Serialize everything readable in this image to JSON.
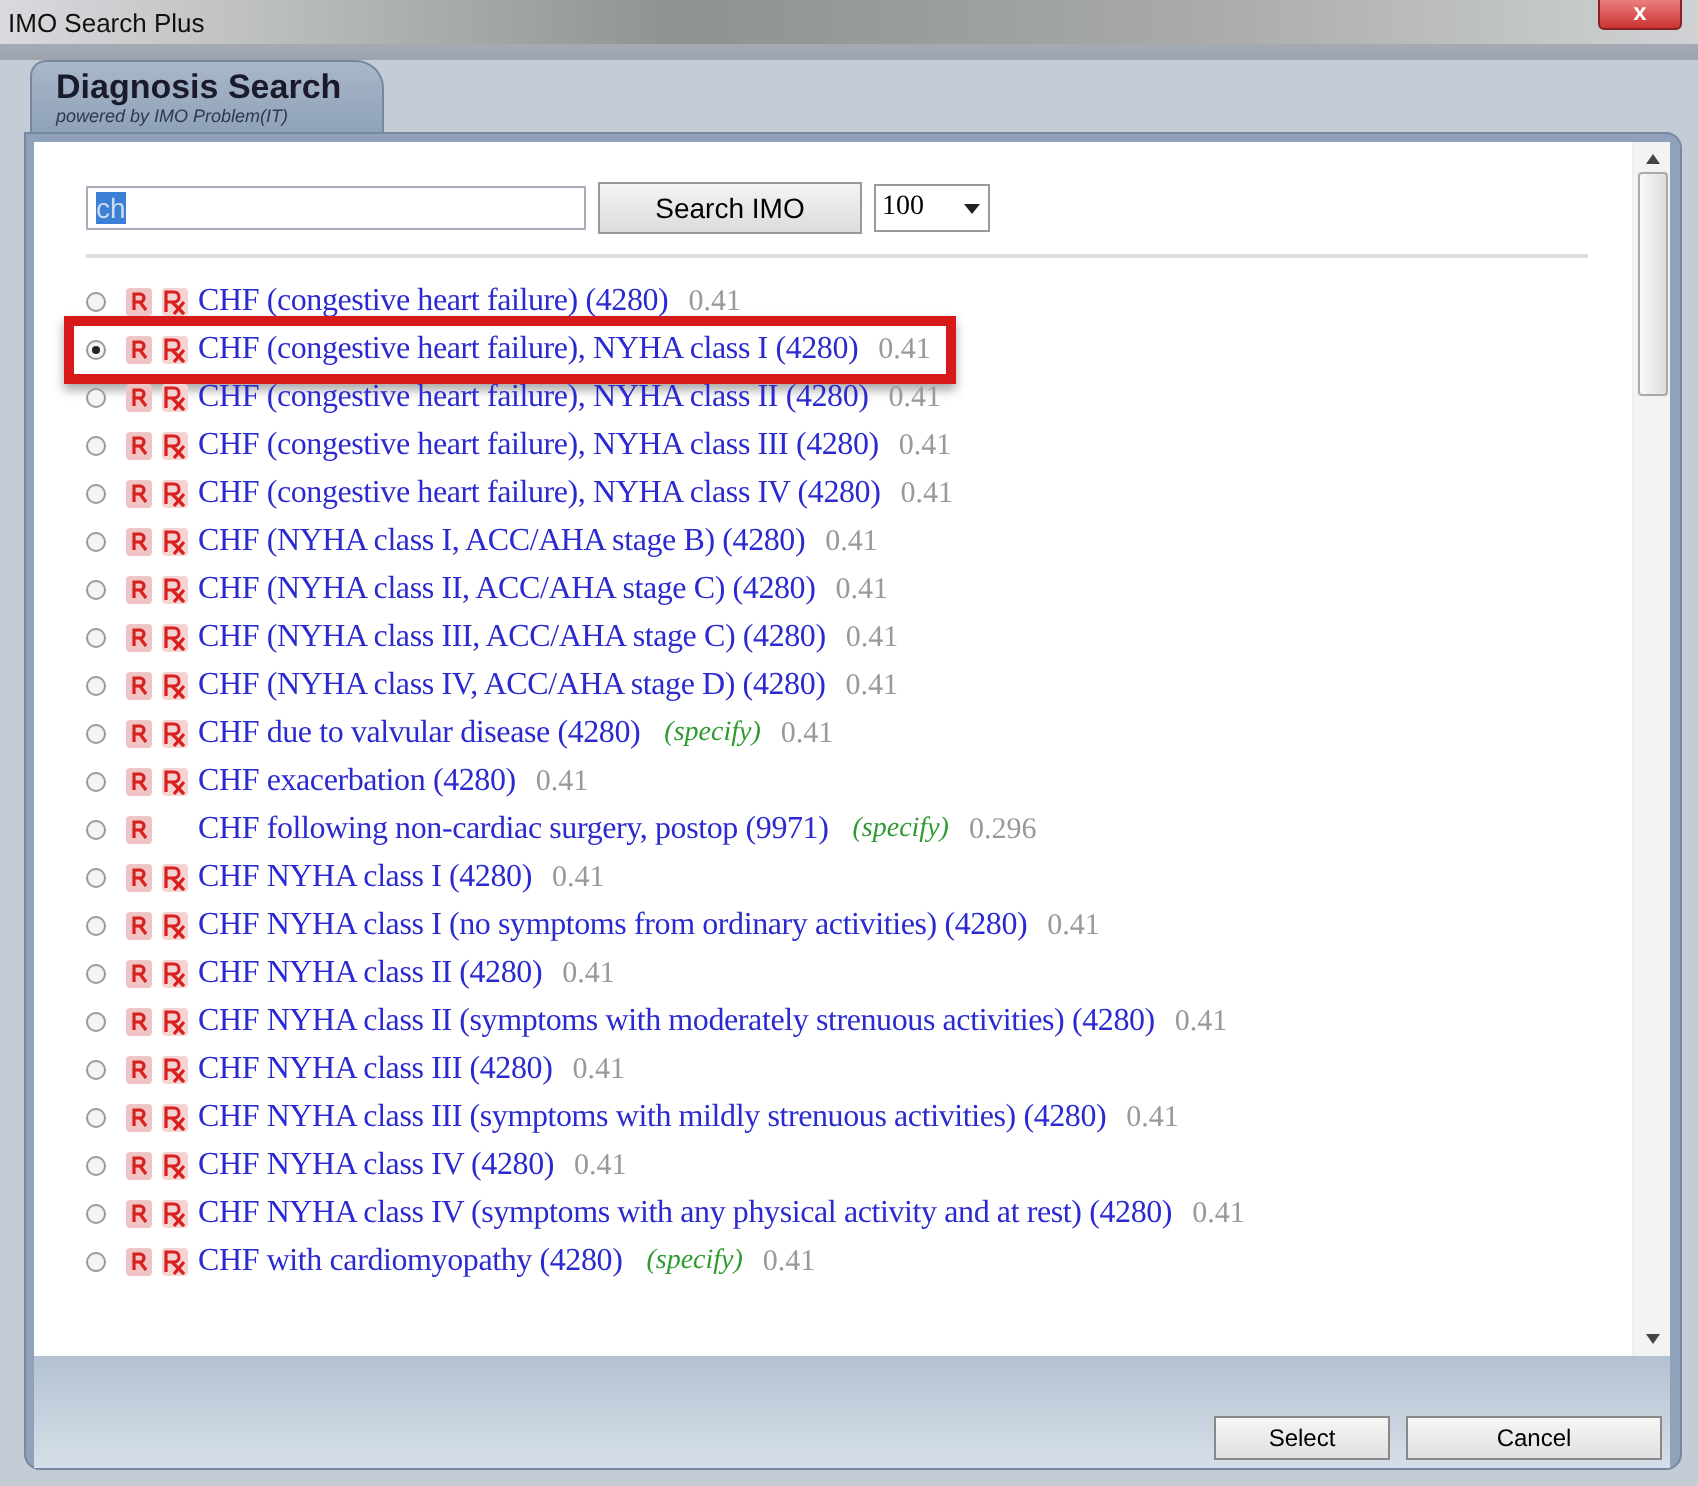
{
  "window": {
    "title": "IMO Search Plus",
    "close": "x"
  },
  "tab": {
    "title": "Diagnosis Search",
    "subtitle": "powered by IMO Problem(IT)"
  },
  "search": {
    "value": "ch",
    "button": "Search IMO",
    "limit": "100"
  },
  "results": [
    {
      "text": "CHF (congestive heart failure) (4280)",
      "rx": true,
      "score": "0.41",
      "selected": false,
      "highlighted": false
    },
    {
      "text": "CHF (congestive heart failure), NYHA class I (4280)",
      "rx": true,
      "score": "0.41",
      "selected": true,
      "highlighted": true
    },
    {
      "text": "CHF (congestive heart failure), NYHA class II (4280)",
      "rx": true,
      "score": "0.41",
      "selected": false,
      "highlighted": false
    },
    {
      "text": "CHF (congestive heart failure), NYHA class III (4280)",
      "rx": true,
      "score": "0.41",
      "selected": false,
      "highlighted": false
    },
    {
      "text": "CHF (congestive heart failure), NYHA class IV (4280)",
      "rx": true,
      "score": "0.41",
      "selected": false,
      "highlighted": false
    },
    {
      "text": "CHF (NYHA class I, ACC/AHA stage B) (4280)",
      "rx": true,
      "score": "0.41",
      "selected": false,
      "highlighted": false
    },
    {
      "text": "CHF (NYHA class II, ACC/AHA stage C) (4280)",
      "rx": true,
      "score": "0.41",
      "selected": false,
      "highlighted": false
    },
    {
      "text": "CHF (NYHA class III, ACC/AHA stage C) (4280)",
      "rx": true,
      "score": "0.41",
      "selected": false,
      "highlighted": false
    },
    {
      "text": "CHF (NYHA class IV, ACC/AHA stage D) (4280)",
      "rx": true,
      "score": "0.41",
      "selected": false,
      "highlighted": false
    },
    {
      "text": "CHF due to valvular disease (4280)",
      "rx": true,
      "specify": "(specify)",
      "score": "0.41",
      "selected": false,
      "highlighted": false
    },
    {
      "text": "CHF exacerbation (4280)",
      "rx": true,
      "score": "0.41",
      "selected": false,
      "highlighted": false
    },
    {
      "text": "CHF following non-cardiac surgery, postop (9971)",
      "rx": false,
      "specify": "(specify)",
      "score": "0.296",
      "selected": false,
      "highlighted": false
    },
    {
      "text": "CHF NYHA class I (4280)",
      "rx": true,
      "score": "0.41",
      "selected": false,
      "highlighted": false
    },
    {
      "text": "CHF NYHA class I (no symptoms from ordinary activities) (4280)",
      "rx": true,
      "score": "0.41",
      "selected": false,
      "highlighted": false
    },
    {
      "text": "CHF NYHA class II (4280)",
      "rx": true,
      "score": "0.41",
      "selected": false,
      "highlighted": false
    },
    {
      "text": "CHF NYHA class II (symptoms with moderately strenuous activities) (4280)",
      "rx": true,
      "score": "0.41",
      "selected": false,
      "highlighted": false
    },
    {
      "text": "CHF NYHA class III (4280)",
      "rx": true,
      "score": "0.41",
      "selected": false,
      "highlighted": false
    },
    {
      "text": "CHF NYHA class III (symptoms with mildly strenuous activities) (4280)",
      "rx": true,
      "score": "0.41",
      "selected": false,
      "highlighted": false
    },
    {
      "text": "CHF NYHA class IV (4280)",
      "rx": true,
      "score": "0.41",
      "selected": false,
      "highlighted": false
    },
    {
      "text": "CHF NYHA class IV (symptoms with any physical activity and at rest) (4280)",
      "rx": true,
      "score": "0.41",
      "selected": false,
      "highlighted": false
    },
    {
      "text": "CHF with cardiomyopathy (4280)",
      "rx": true,
      "specify": "(specify)",
      "score": "0.41",
      "selected": false,
      "highlighted": false
    }
  ],
  "buttons": [
    "Select",
    "Cancel"
  ]
}
